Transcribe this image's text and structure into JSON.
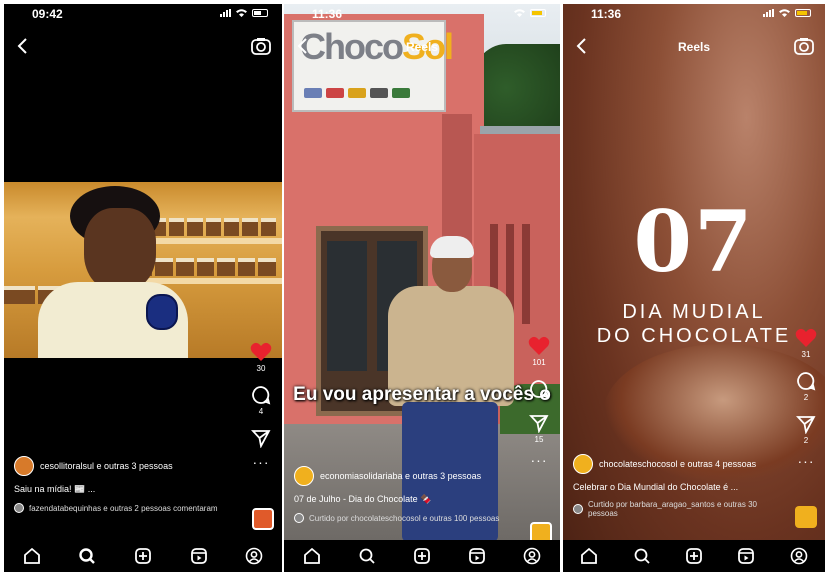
{
  "phones": [
    {
      "status_time": "09:42",
      "username_line": "cesollitoralsul e outras 3 pessoas",
      "caption": "Saiu na mídia! 📰 ...",
      "comment_line": "fazendatabequinhas e outras 2 pessoas comentaram",
      "likes": "30",
      "comments": "4",
      "icons": [
        "back-icon",
        "camera-icon",
        "heart-icon",
        "comment-icon",
        "share-icon",
        "more-icon"
      ]
    },
    {
      "status_time": "11:36",
      "title": "Reels",
      "sign_text_grey": "Choco",
      "sign_text_yellow": "Sol",
      "subtitle": "Eu vou apresentar a vocês o",
      "username_line": "economiasolidariaba e outras 3 pessoas",
      "caption": "07 de Julho - Dia do Chocolate 🍫",
      "liked_line": "Curtido por chocolateschocosol e outras 100 pessoas",
      "likes": "101",
      "shares": "15"
    },
    {
      "status_time": "11:36",
      "title": "Reels",
      "big_number": "07",
      "day_line1": "DIA MUDIAL",
      "day_line2": "DO CHOCOLATE",
      "username_line": "chocolateschocosol e outras 4 pessoas",
      "caption": "Celebrar o Dia Mundial do Chocolate é ...",
      "liked_line": "Curtido por barbara_aragao_santos e outras 30 pessoas",
      "likes": "31",
      "comments": "2",
      "shares": "2"
    }
  ],
  "colors": {
    "like_red": "#e8222e",
    "choco_yellow": "#f0b01e"
  },
  "navbar_icons": [
    "home-icon",
    "search-icon",
    "create-icon",
    "reels-icon",
    "profile-icon"
  ]
}
